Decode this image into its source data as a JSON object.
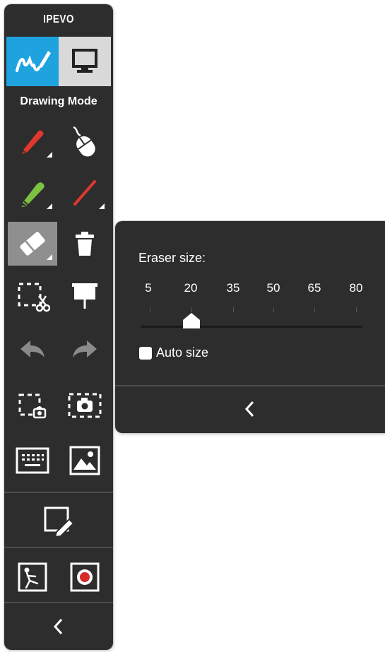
{
  "toolbar": {
    "brand": "IPEVO",
    "mode_label": "Drawing Mode",
    "tabs": [
      {
        "name": "drawing-mode",
        "icon": "handwriting-pen-icon",
        "active": true
      },
      {
        "name": "desktop-mode",
        "icon": "monitor-icon",
        "active": false
      }
    ],
    "tools": [
      {
        "name": "red-pen-tool",
        "icon": "red-pen-icon",
        "color": "#e0382c"
      },
      {
        "name": "mouse-tool",
        "icon": "mouse-icon"
      },
      {
        "name": "highlighter-tool",
        "icon": "green-highlighter-icon",
        "color": "#7cc242"
      },
      {
        "name": "line-tool",
        "icon": "red-line-icon",
        "color": "#e0382c"
      },
      {
        "name": "eraser-tool",
        "icon": "eraser-icon",
        "selected": true
      },
      {
        "name": "clear-all-tool",
        "icon": "trash-icon"
      },
      {
        "name": "cut-tool",
        "icon": "selection-scissors-icon"
      },
      {
        "name": "whiteboard-tool",
        "icon": "projection-screen-icon"
      },
      {
        "name": "undo-button",
        "icon": "undo-arrow-icon"
      },
      {
        "name": "redo-button",
        "icon": "redo-arrow-icon"
      },
      {
        "name": "region-capture-button",
        "icon": "region-camera-icon"
      },
      {
        "name": "screen-capture-button",
        "icon": "screen-camera-icon"
      },
      {
        "name": "keyboard-button",
        "icon": "keyboard-icon"
      },
      {
        "name": "insert-image-button",
        "icon": "image-icon"
      },
      {
        "name": "whiteboard-mode-button",
        "icon": "board-pen-icon"
      },
      {
        "name": "animation-button",
        "icon": "stop-motion-icon"
      },
      {
        "name": "record-button",
        "icon": "record-icon"
      }
    ],
    "collapse_icon": "chevron-left-icon"
  },
  "eraser_popup": {
    "size_label": "Eraser size:",
    "sizes": [
      "5",
      "20",
      "35",
      "50",
      "65",
      "80"
    ],
    "selected_size": 20,
    "auto_size_label": "Auto size",
    "auto_size_checked": false,
    "collapse_icon": "chevron-left-icon"
  },
  "colors": {
    "panel": "#2d2d2d",
    "accent_blue": "#1ea3de",
    "selected_tool": "#8f8f8f",
    "pen_red": "#e0382c",
    "highlighter_green": "#7cc242"
  }
}
